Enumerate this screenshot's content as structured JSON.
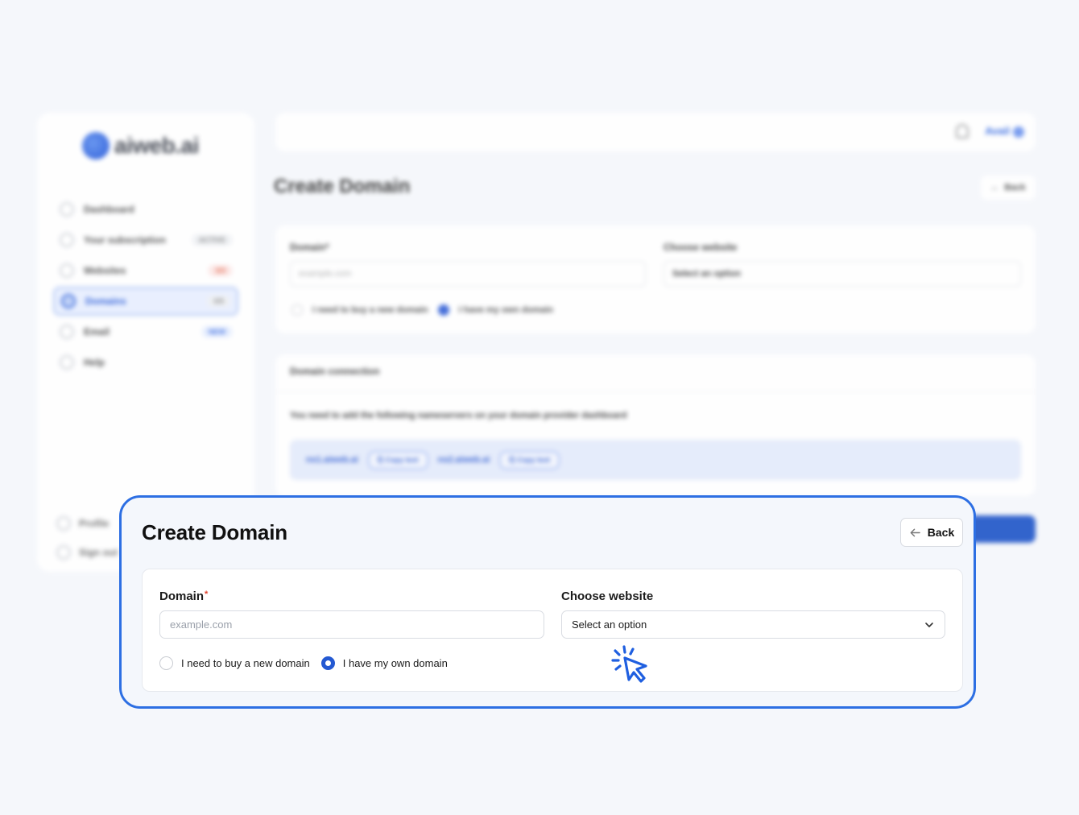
{
  "colors": {
    "accent": "#2d6fe3",
    "primary": "#2459d2",
    "required": "#e0432f",
    "background": "#f4f7fc"
  },
  "background_app": {
    "logo_text": "aiweb.ai",
    "nav": [
      {
        "label": "Dashboard",
        "badge": ""
      },
      {
        "label": "Your subscription",
        "badge": "ACTIVE"
      },
      {
        "label": "Websites",
        "badge": "3/3"
      },
      {
        "label": "Domains",
        "badge": "0/5"
      },
      {
        "label": "Email",
        "badge": "NEW"
      },
      {
        "label": "Help",
        "badge": ""
      }
    ],
    "nav_bottom": [
      "Profile",
      "Sign out"
    ],
    "user_name": "Avail",
    "page_title": "Create Domain",
    "back_label": "Back",
    "domain_label": "Domain",
    "domain_placeholder": "example.com",
    "website_label": "Choose website",
    "website_value": "Select an option",
    "radio_buy": "I need to buy a new domain",
    "radio_own": "I have my own domain",
    "connection_title": "Domain connection",
    "connection_text": "You need to add the following nameservers on your domain provider dashboard",
    "nameservers": [
      {
        "host": "ns1.aiweb.ai",
        "copy_label": "Copy text"
      },
      {
        "host": "ns2.aiweb.ai",
        "copy_label": "Copy text"
      }
    ]
  },
  "focus": {
    "page_title": "Create Domain",
    "back_label": "Back",
    "domain_label": "Domain",
    "required_mark": "*",
    "domain_placeholder": "example.com",
    "website_label": "Choose website",
    "website_value": "Select an option",
    "radio_options": [
      {
        "label": "I need to buy a new domain",
        "checked": false
      },
      {
        "label": "I have my own domain",
        "checked": true
      }
    ]
  },
  "icons": {
    "back": "arrow-left-icon",
    "select": "chevron-down-icon",
    "cursor": "click-cursor-icon"
  }
}
